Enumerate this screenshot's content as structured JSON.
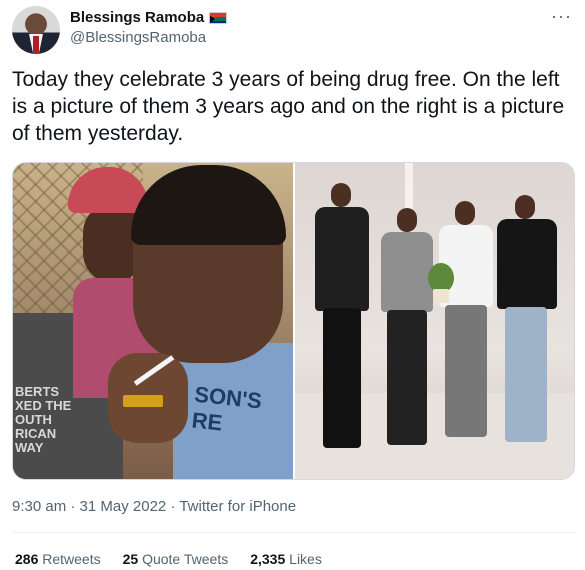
{
  "author": {
    "display_name": "Blessings Ramoba",
    "handle": "@BlessingsRamoba",
    "flag_icon": "south-africa-flag-icon"
  },
  "more_label": "···",
  "tweet": {
    "text": "Today they celebrate 3 years of being drug free. On the left is a picture of them 3 years ago and on the right is a picture of them yesterday."
  },
  "media": {
    "left_photo_sign_text": "BERTS\nXED THE\nOUTH\nRICAN\nWAY",
    "left_photo_shirt_text": "SON'S\nRE"
  },
  "meta": {
    "time": "9:30 am",
    "separator1": " · ",
    "date": "31 May 2022",
    "separator2": " · ",
    "source": "Twitter for iPhone"
  },
  "stats": {
    "retweets_count": "286",
    "retweets_label": "Retweets",
    "quotes_count": "25",
    "quotes_label": "Quote Tweets",
    "likes_count": "2,335",
    "likes_label": "Likes"
  },
  "colors": {
    "text_primary": "#0f1419",
    "text_secondary": "#536471",
    "border": "#cfd9de"
  }
}
